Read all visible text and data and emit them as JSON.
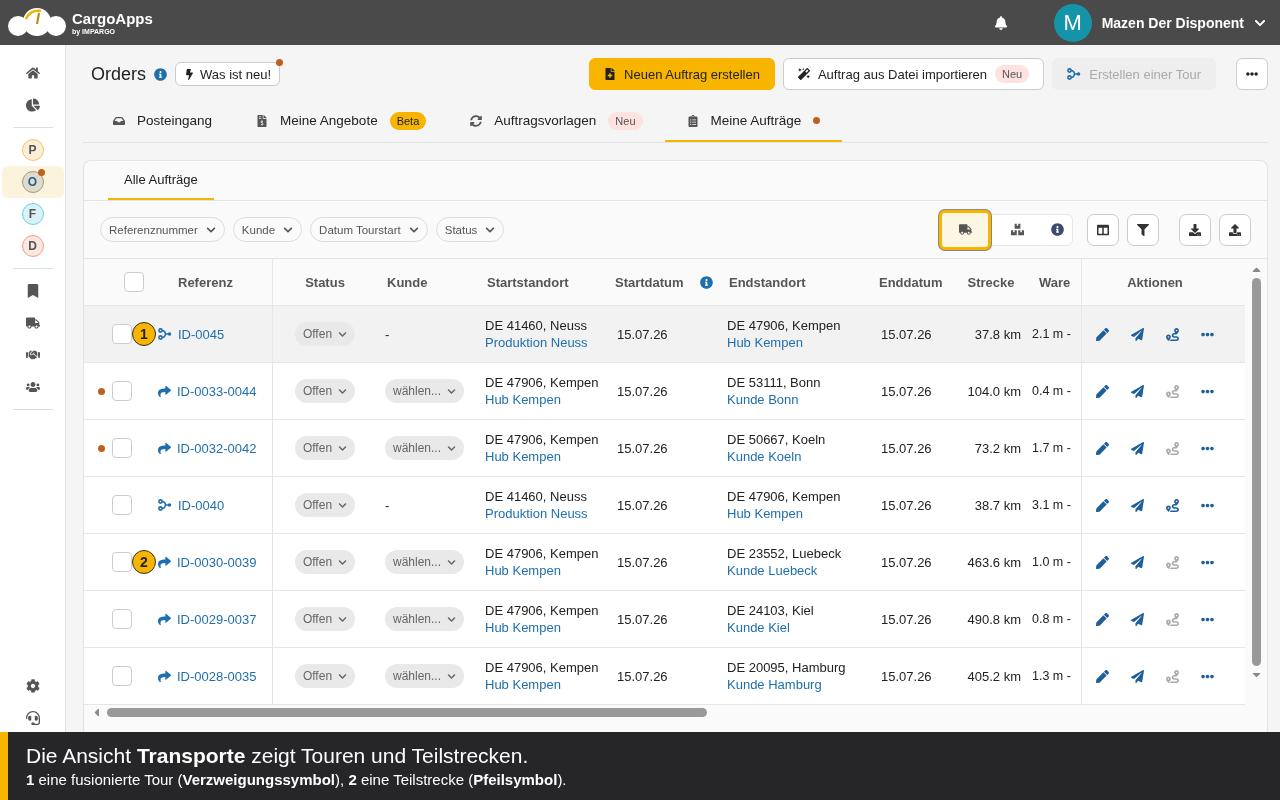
{
  "app": {
    "name": "CargoApps",
    "tagline": "by IMPARGO"
  },
  "user": {
    "initial": "M",
    "name": "Mazen Der Disponent"
  },
  "sidebar_apps": [
    {
      "letter": "P",
      "color": "#f5c26b",
      "selected": false,
      "notify": false
    },
    {
      "letter": "O",
      "color": "#9a9a9a",
      "selected": true,
      "notify": true
    },
    {
      "letter": "F",
      "color": "#6fd0e6",
      "selected": false,
      "notify": false
    },
    {
      "letter": "D",
      "color": "#f0a08a",
      "selected": false,
      "notify": false
    }
  ],
  "page": {
    "title": "Orders",
    "whats_new": "Was ist neu!",
    "whats_new_dot": true
  },
  "actions": [
    {
      "label": "Neuen Auftrag erstellen",
      "kind": "primary",
      "disabled": false
    },
    {
      "label": "Auftrag aus Datei importieren",
      "kind": "import",
      "badge": "Neu",
      "disabled": false
    },
    {
      "label": "Erstellen einer Tour",
      "kind": "tour",
      "disabled": true
    }
  ],
  "tabs": [
    {
      "label": "Posteingang",
      "kind": "inbox",
      "selected": false,
      "dot": false
    },
    {
      "label": "Meine Angebote",
      "kind": "offers",
      "badge": "Beta",
      "selected": false,
      "dot": false
    },
    {
      "label": "Auftragsvorlagen",
      "kind": "templates",
      "badge": "Neu",
      "selected": false,
      "dot": false
    },
    {
      "label": "Meine Aufträge",
      "kind": "orders",
      "selected": true,
      "dot": true
    }
  ],
  "subtabs": [
    {
      "label": "Alle Aufträge",
      "selected": true
    }
  ],
  "filters": [
    "Referenznummer",
    "Kunde",
    "Datum Tourstart",
    "Status"
  ],
  "view_toggle": [
    {
      "kind": "transport",
      "selected": true
    },
    {
      "kind": "goods",
      "selected": false
    }
  ],
  "table": {
    "all_checked": false,
    "columns": [
      {
        "label": "Referenz"
      },
      {
        "label": "Status"
      },
      {
        "label": "Kunde"
      },
      {
        "label": "Startstandort"
      },
      {
        "label": "Startdatum",
        "info": true
      },
      {
        "label": "Endstandort"
      },
      {
        "label": "Enddatum"
      },
      {
        "label": "Strecke"
      },
      {
        "label": "Ware"
      },
      {
        "label": "Aktionen"
      }
    ],
    "rows": [
      {
        "unread": false,
        "checked": false,
        "highlighted": true,
        "marker": "1",
        "kind": "tour",
        "ref": "ID-0045",
        "status": "Offen",
        "customer": "-",
        "customer_select": false,
        "start": "DE 41460, Neuss",
        "start_site": "Produktion Neuss",
        "start_date": "15.07.26",
        "end": "DE 47906, Kempen",
        "end_site": "Hub Kempen",
        "end_date": "15.07.26",
        "distance": "37.8 km",
        "goods": "2.1 m -",
        "route_enabled": true
      },
      {
        "unread": true,
        "checked": false,
        "highlighted": false,
        "kind": "leg",
        "ref": "ID-0033-0044",
        "status": "Offen",
        "customer": "wählen...",
        "customer_select": true,
        "start": "DE 47906, Kempen",
        "start_site": "Hub Kempen",
        "start_date": "15.07.26",
        "end": "DE 53111, Bonn",
        "end_site": "Kunde Bonn",
        "end_date": "15.07.26",
        "distance": "104.0 km",
        "goods": "0.4 m -",
        "route_enabled": false
      },
      {
        "unread": true,
        "checked": false,
        "highlighted": false,
        "kind": "leg",
        "ref": "ID-0032-0042",
        "status": "Offen",
        "customer": "wählen...",
        "customer_select": true,
        "start": "DE 47906, Kempen",
        "start_site": "Hub Kempen",
        "start_date": "15.07.26",
        "end": "DE 50667, Koeln",
        "end_site": "Kunde Koeln",
        "end_date": "15.07.26",
        "distance": "73.2 km",
        "goods": "1.7 m -",
        "route_enabled": false
      },
      {
        "unread": false,
        "checked": false,
        "highlighted": false,
        "kind": "tour",
        "ref": "ID-0040",
        "status": "Offen",
        "customer": "-",
        "customer_select": false,
        "start": "DE 41460, Neuss",
        "start_site": "Produktion Neuss",
        "start_date": "15.07.26",
        "end": "DE 47906, Kempen",
        "end_site": "Hub Kempen",
        "end_date": "15.07.26",
        "distance": "38.7 km",
        "goods": "3.1 m -",
        "route_enabled": true
      },
      {
        "unread": false,
        "checked": false,
        "highlighted": false,
        "marker": "2",
        "kind": "leg",
        "ref": "ID-0030-0039",
        "status": "Offen",
        "customer": "wählen...",
        "customer_select": true,
        "start": "DE 47906, Kempen",
        "start_site": "Hub Kempen",
        "start_date": "15.07.26",
        "end": "DE 23552, Luebeck",
        "end_site": "Kunde Luebeck",
        "end_date": "15.07.26",
        "distance": "463.6 km",
        "goods": "1.0 m -",
        "route_enabled": false
      },
      {
        "unread": false,
        "checked": false,
        "highlighted": false,
        "kind": "leg",
        "ref": "ID-0029-0037",
        "status": "Offen",
        "customer": "wählen...",
        "customer_select": true,
        "start": "DE 47906, Kempen",
        "start_site": "Hub Kempen",
        "start_date": "15.07.26",
        "end": "DE 24103, Kiel",
        "end_site": "Kunde Kiel",
        "end_date": "15.07.26",
        "distance": "490.8 km",
        "goods": "0.8 m -",
        "route_enabled": false
      },
      {
        "unread": false,
        "checked": false,
        "highlighted": false,
        "kind": "leg",
        "ref": "ID-0028-0035",
        "status": "Offen",
        "customer": "wählen...",
        "customer_select": true,
        "start": "DE 47906, Kempen",
        "start_site": "Hub Kempen",
        "start_date": "15.07.26",
        "end": "DE 20095, Hamburg",
        "end_site": "Kunde Hamburg",
        "end_date": "15.07.26",
        "distance": "405.2 km",
        "goods": "1.3 m -",
        "route_enabled": false
      }
    ]
  },
  "caption": {
    "title": "Die Ansicht **Transporte** zeigt Touren und Teilstrecken.",
    "text": "**1** eine fusionierte Tour (**Verzweigungssymbol**), **2** eine Teilstrecke (**Pfeilsymbol**)."
  }
}
